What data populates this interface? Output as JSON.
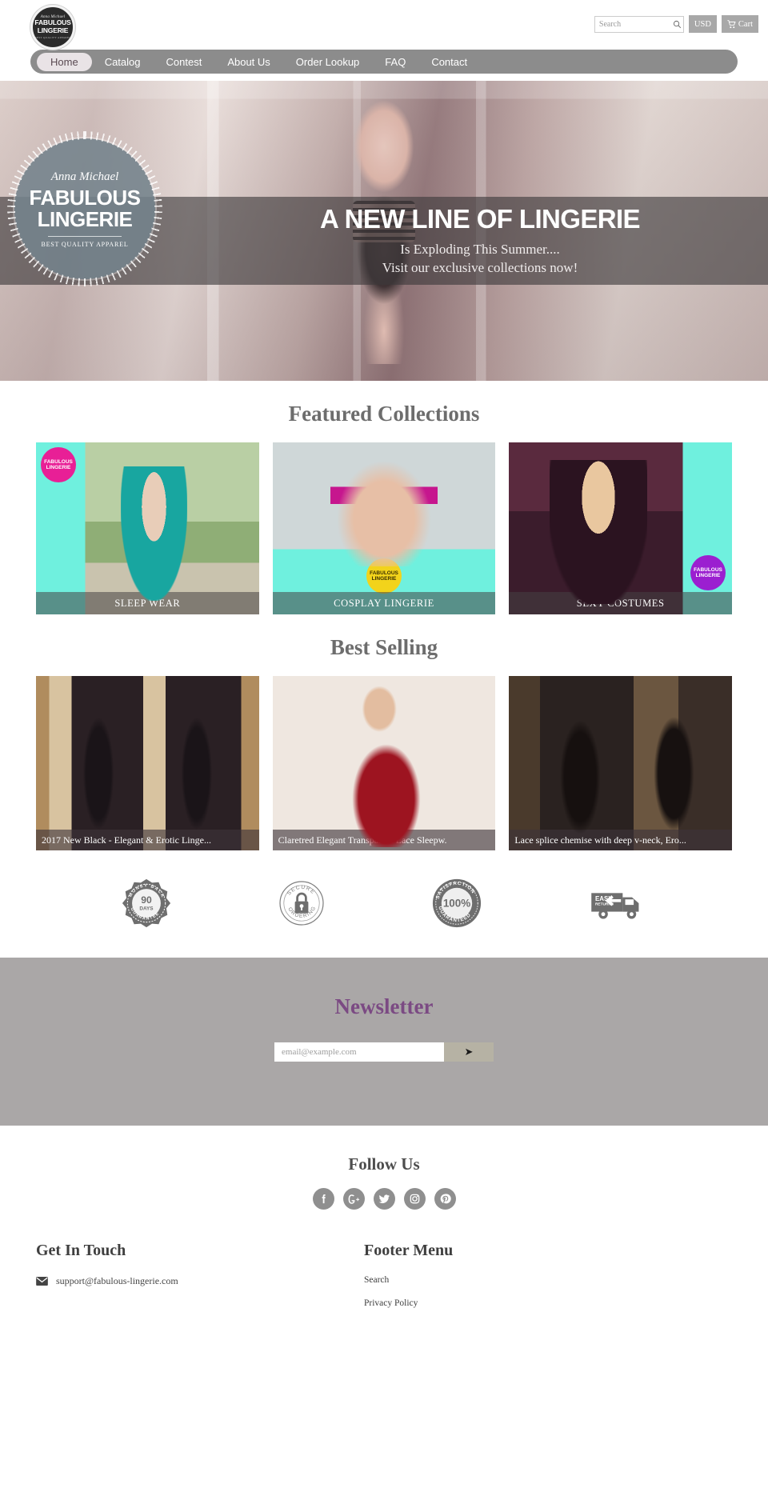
{
  "brand": {
    "script": "Anna Michael",
    "line1": "FABULOUS",
    "line2": "LINGERIE",
    "tagline": "BEST QUALITY APPAREL"
  },
  "header": {
    "search_placeholder": "Search",
    "search_value": "",
    "currency": "USD",
    "cart": "Cart"
  },
  "nav": {
    "items": [
      {
        "label": "Home",
        "active": true
      },
      {
        "label": "Catalog",
        "active": false
      },
      {
        "label": "Contest",
        "active": false
      },
      {
        "label": "About Us",
        "active": false
      },
      {
        "label": "Order Lookup",
        "active": false
      },
      {
        "label": "FAQ",
        "active": false
      },
      {
        "label": "Contact",
        "active": false
      }
    ]
  },
  "hero": {
    "headline": "A NEW LINE OF LINGERIE",
    "sub1": "Is Exploding This Summer....",
    "sub2": "Visit our exclusive collections now!"
  },
  "featured": {
    "title": "Featured Collections",
    "cards": [
      {
        "label": "SLEEP WEAR",
        "chip": "FABULOUS LINGERIE"
      },
      {
        "label": "COSPLAY LINGERIE",
        "chip": "FABULOUS LINGERIE"
      },
      {
        "label": "SEXY COSTUMES",
        "chip": "FABULOUS LINGERIE"
      }
    ]
  },
  "bestselling": {
    "title": "Best Selling",
    "cards": [
      {
        "label": "2017 New Black - Elegant & Erotic Linge..."
      },
      {
        "label": "Claretred Elegant Transparent Lace Sleepw."
      },
      {
        "label": "Lace splice chemise with deep v-neck, Ero..."
      }
    ]
  },
  "trust": {
    "badges": [
      {
        "name": "money-back-guarantee",
        "top": "MONEY BACK",
        "big": "90",
        "small": "DAYS",
        "bottom": "GUARANTEE"
      },
      {
        "name": "secure-ordering",
        "top": "SECURE",
        "bottom": "ORDERING"
      },
      {
        "name": "satisfaction-guaranteed",
        "top": "SATISFACTION",
        "big": "100%",
        "bottom": "GUARANTEED"
      },
      {
        "name": "easy-returns",
        "line1": "EASY",
        "line2": "RETURNS"
      }
    ]
  },
  "newsletter": {
    "title": "Newsletter",
    "placeholder": "email@example.com",
    "value": "",
    "submit": "➤",
    "accent": "#7b4a83",
    "bg": "#aaa7a7"
  },
  "follow": {
    "title": "Follow Us",
    "networks": [
      "facebook",
      "google-plus",
      "twitter",
      "instagram",
      "pinterest"
    ]
  },
  "footer": {
    "contact_title": "Get In Touch",
    "email": "support@fabulous-lingerie.com",
    "menu_title": "Footer Menu",
    "menu": [
      "Search",
      "Privacy Policy"
    ]
  }
}
